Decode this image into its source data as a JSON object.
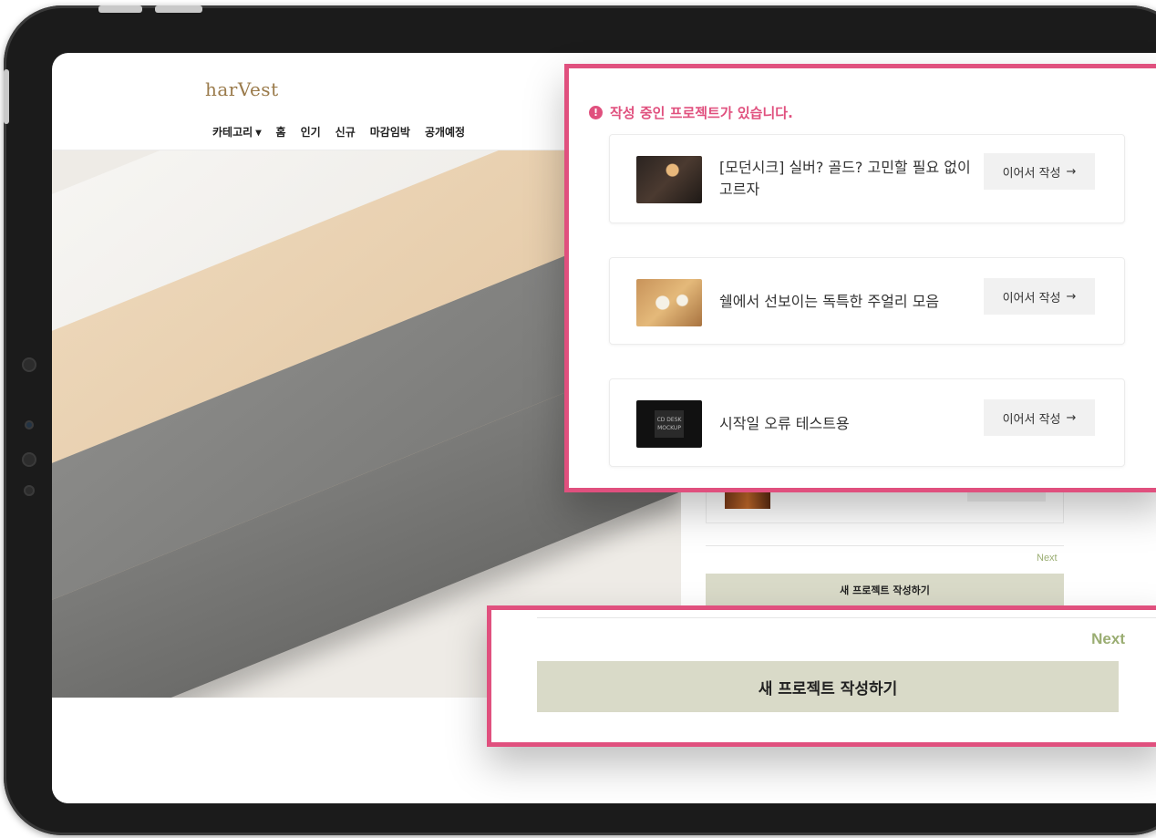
{
  "site": {
    "logo": "harVest",
    "nav": [
      "카테고리 ▾",
      "홈",
      "인기",
      "신규",
      "마감임박",
      "공개예정"
    ]
  },
  "notice": {
    "icon": "exclamation-circle-icon",
    "text": "작성 중인 프로젝트가 있습니다."
  },
  "projects": [
    {
      "title": "[모던시크] 실버? 골드? 고민할 필요 없이 고르자",
      "button": "이어서 작성",
      "thumbnail": "jewelry-necklace-photo"
    },
    {
      "title": "쉘에서 선보이는 독특한 주얼리 모음",
      "button": "이어서 작성",
      "thumbnail": "jewelry-shell-photo"
    },
    {
      "title": "시작일 오류 테스트용",
      "button": "이어서 작성",
      "thumbnail": "cd-desk-mockup-photo"
    }
  ],
  "cd_thumb_text": "CD DESK MOCKUP",
  "footer": {
    "next": "Next",
    "create": "새 프로젝트 작성하기"
  },
  "colors": {
    "accent_pink": "#e0507e",
    "next_green": "#9aad72",
    "create_bg": "#d9dac8",
    "logo_brown": "#9a7a4a"
  }
}
